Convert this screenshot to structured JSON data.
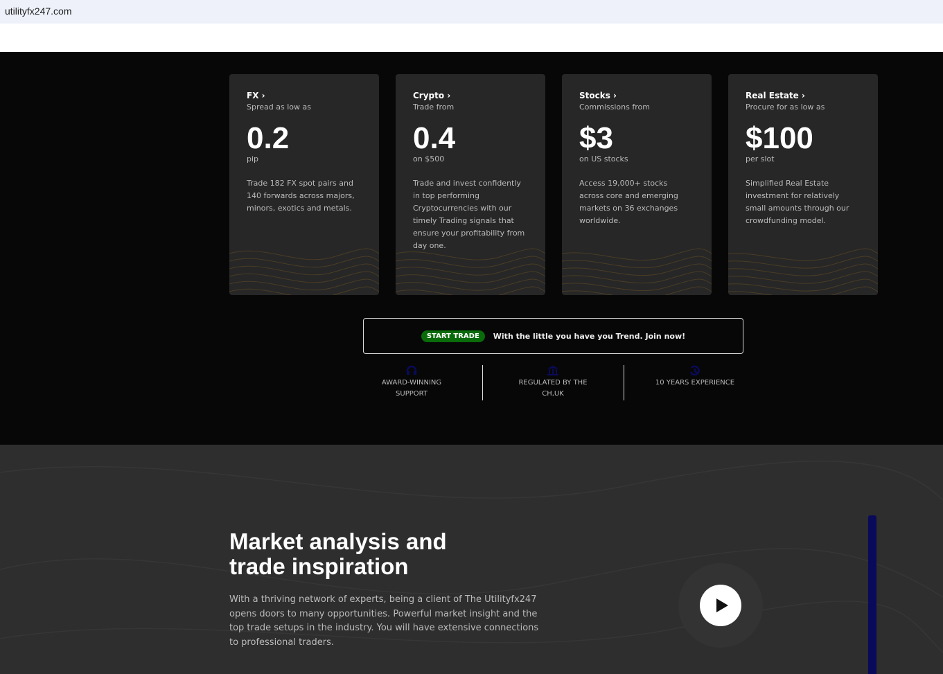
{
  "browser": {
    "url": "utilityfx247.com"
  },
  "cards": [
    {
      "title": "FX",
      "sub": "Spread as low as",
      "value": "0.2",
      "unit": "pip",
      "desc": "Trade 182 FX spot pairs and 140 forwards across majors, minors, exotics and metals."
    },
    {
      "title": "Crypto",
      "sub": "Trade from",
      "value": "0.4",
      "unit": "on $500",
      "desc": "Trade and invest confidently in top performing Cryptocurrencies with our timely Trading signals that ensure your profitability from day one."
    },
    {
      "title": "Stocks",
      "sub": "Commissions from",
      "value": "$3",
      "unit": "on US stocks",
      "desc": "Access 19,000+ stocks across core and emerging markets on 36 exchanges worldwide."
    },
    {
      "title": "Real Estate",
      "sub": "Procure for as low as",
      "value": "$100",
      "unit": "per slot",
      "desc": "Simplified Real Estate investment for relatively small amounts through our crowdfunding model."
    }
  ],
  "banner": {
    "button": "START TRADE",
    "text": "With the little you have you Trend. Join now!"
  },
  "features": [
    {
      "icon": "headset-icon",
      "line1": "AWARD-WINNING",
      "line2": "SUPPORT"
    },
    {
      "icon": "bank-icon",
      "line1": "REGULATED BY THE",
      "line2": "CH,UK"
    },
    {
      "icon": "history-icon",
      "line1": "10 YEARS EXPERIENCE",
      "line2": ""
    }
  ],
  "analysis": {
    "title_line1": "Market analysis and",
    "title_line2": "trade inspiration",
    "body": "With a thriving network of experts, being a client of The Utilityfx247 opens doors to many opportunities. Powerful market insight and the top trade setups in the industry. You will have extensive connections to professional traders."
  },
  "colors": {
    "accent_green": "#0a6b0a",
    "icon_blue": "#0a0a5a"
  }
}
